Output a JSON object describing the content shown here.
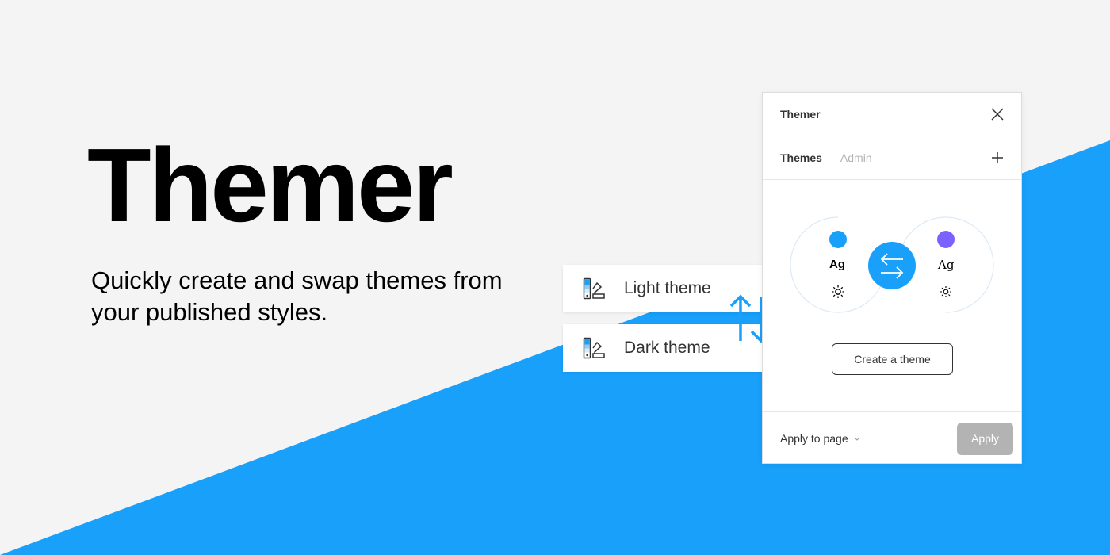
{
  "colors": {
    "background": "#f4f4f4",
    "accent_blue": "#18a0fb",
    "purple": "#7b61ff",
    "disabled_gray": "#b3b3b3"
  },
  "hero": {
    "title": "Themer",
    "subtitle": "Quickly create and swap themes from your published styles."
  },
  "theme_cards": [
    {
      "label": "Light theme",
      "icon": "theme-style-icon"
    },
    {
      "label": "Dark theme",
      "icon": "theme-style-icon"
    }
  ],
  "panel": {
    "title": "Themer",
    "close_icon": "close-icon",
    "tabs": [
      {
        "label": "Themes",
        "active": true
      },
      {
        "label": "Admin",
        "active": false
      }
    ],
    "add_icon": "plus-icon",
    "preview": {
      "left": {
        "sample_text": "Ag",
        "swatch_color": "#18a0fb",
        "icon": "sun-icon"
      },
      "right": {
        "sample_text": "Ag",
        "swatch_color": "#7b61ff",
        "icon": "sun-icon"
      },
      "swap_icon": "swap-arrows-icon"
    },
    "create_button": "Create a theme",
    "footer": {
      "scope_label": "Apply to page",
      "apply_button": "Apply"
    }
  }
}
